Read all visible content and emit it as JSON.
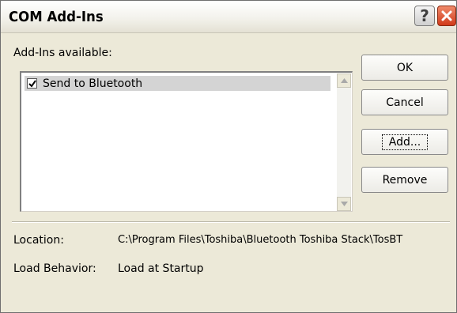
{
  "window": {
    "title": "COM Add-Ins",
    "help_glyph": "?",
    "close_icon": "close-icon"
  },
  "addins": {
    "label": "Add-Ins available:",
    "items": [
      {
        "label": "Send to Bluetooth",
        "checked": true,
        "selected": true
      }
    ]
  },
  "buttons": {
    "ok": "OK",
    "cancel": "Cancel",
    "add": "Add...",
    "remove": "Remove"
  },
  "details": {
    "location_label": "Location:",
    "location_value": "C:\\Program Files\\Toshiba\\Bluetooth Toshiba Stack\\TosBT",
    "load_behavior_label": "Load Behavior:",
    "load_behavior_value": "Load at Startup"
  }
}
